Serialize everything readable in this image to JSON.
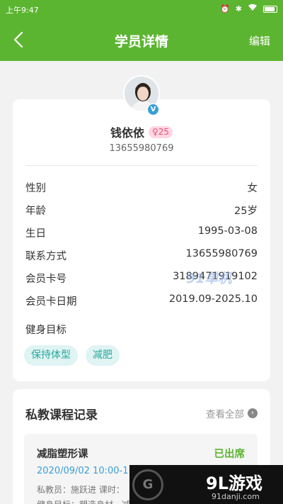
{
  "status_bar": {
    "time": "上午9:47"
  },
  "header": {
    "title": "学员详情",
    "edit_label": "编辑"
  },
  "profile": {
    "name": "钱依依",
    "age_badge": "♀25",
    "phone": "13655980769",
    "verified_mark": "V"
  },
  "info": [
    {
      "label": "性别",
      "value": "女"
    },
    {
      "label": "年龄",
      "value": "25岁"
    },
    {
      "label": "生日",
      "value": "1995-03-08"
    },
    {
      "label": "联系方式",
      "value": "13655980769"
    },
    {
      "label": "会员卡号",
      "value": "3189471919102"
    },
    {
      "label": "会员卡日期",
      "value": "2019.09-2025.10"
    }
  ],
  "goals": {
    "label": "健身目标",
    "tags": [
      "保持体型",
      "减肥"
    ]
  },
  "records": {
    "title": "私教课程记录",
    "view_all": "查看全部",
    "course": {
      "name": "减脂塑形课",
      "status": "已出席",
      "time": "2020/09/02 10:00-11:00",
      "meta": "私教员：施跃进    课时：",
      "goal": "健身目标：塑造身材、减脂"
    }
  },
  "watermarks": {
    "brand": "9L游戏",
    "site": "91danji.com",
    "mark1": "91单机"
  },
  "colors": {
    "accent": "#5cb531",
    "tag_bg": "#dff4f3",
    "tag_text": "#2aa89c",
    "time_blue": "#3a9ed8"
  }
}
